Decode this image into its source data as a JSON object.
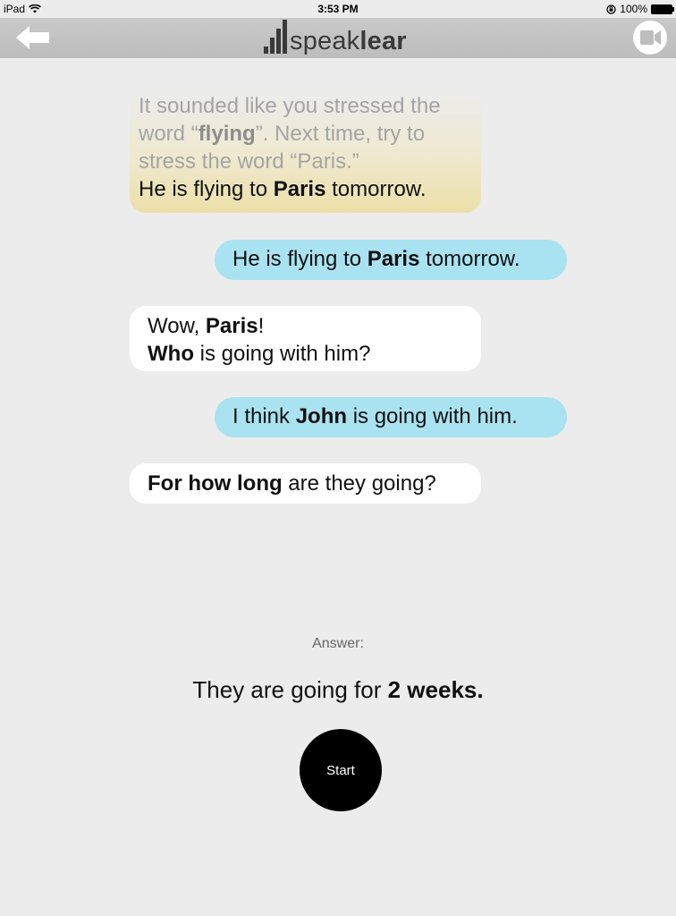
{
  "status_bar": {
    "device": "iPad",
    "time": "3:53 PM",
    "battery": "100%"
  },
  "navbar": {
    "logo_light": "speak",
    "logo_bold": "lear",
    "back_icon": "arrow-left-icon",
    "video_icon": "video-camera-icon"
  },
  "chat": {
    "feedback": {
      "hint_pre": "It sounded like you stressed the word “",
      "hint_word": "flying",
      "hint_post": "”. Next time, try to stress the word “Paris.”",
      "sentence_pre": "He is flying to ",
      "sentence_bold": "Paris",
      "sentence_post": " tomorrow."
    },
    "user_1": {
      "pre": "He is flying to ",
      "bold": "Paris",
      "post": " tomorrow."
    },
    "bot_1": {
      "line1_pre": "Wow, ",
      "line1_bold": "Paris",
      "line1_post": "!",
      "line2_bold": "Who",
      "line2_post": " is going with him?"
    },
    "user_2": {
      "pre": "I think ",
      "bold": "John",
      "post": " is going with him."
    },
    "bot_2": {
      "bold": "For how long",
      "post": " are they going?"
    }
  },
  "answer": {
    "label": "Answer:",
    "text_pre": "They are going for ",
    "text_bold": "2 weeks."
  },
  "start_button": {
    "label": "Start"
  },
  "colors": {
    "navbar": "#c4c4c4",
    "user_bubble": "#a9e3f1",
    "bot_bubble": "#ffffff",
    "feedback_gradient_end": "#ebdfa8",
    "start_button": "#000000"
  }
}
